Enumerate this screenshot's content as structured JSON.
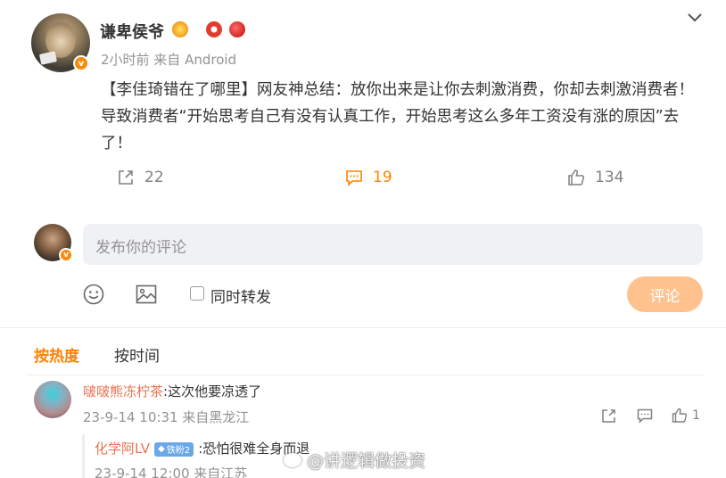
{
  "post": {
    "username": "谦卑侯爷",
    "meta": "2小时前  来自 Android",
    "text_tag": "【李佳琦错在了哪里】",
    "text_body": "网友神总结：放你出来是让你去刺激消费，你却去刺激消费者！导致消费者“开始思考自己有没有认真工作，开始思考这么多年工资没有涨的原因”去了！",
    "verified_label": "v",
    "actions": {
      "repost_count": "22",
      "comment_count": "19",
      "like_count": "134"
    }
  },
  "compose": {
    "placeholder": "发布你的评论",
    "repost_label": "同时转发",
    "submit_label": "评论"
  },
  "sort": {
    "hot": "按热度",
    "time": "按时间"
  },
  "comments": [
    {
      "user": "啵啵熊冻柠茶",
      "text": ":这次他要凉透了",
      "meta": "23-9-14 10:31 来自黑龙江",
      "like_count": "1"
    }
  ],
  "reply": {
    "user": "化学阿LV",
    "badge": "铁粉2",
    "text": ":恐怕很难全身而退",
    "meta": "23-9-14 12:00 来自江苏"
  },
  "watermark": "@讲逻辑做投资",
  "colors": {
    "accent": "#ff8200",
    "username_link": "#eb7350",
    "submit_disabled": "#ffc28e",
    "compose_bg": "#f0f1f4"
  }
}
